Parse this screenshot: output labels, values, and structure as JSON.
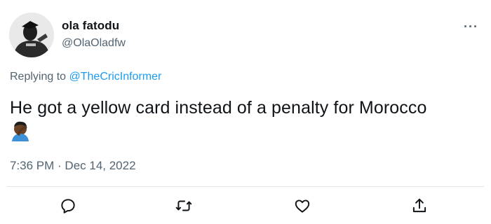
{
  "author": {
    "display_name": "ola fatodu",
    "handle": "@OlaOladfw"
  },
  "reply": {
    "prefix": "Replying to",
    "mention": "@TheCricInformer"
  },
  "tweet": {
    "text": "He got a yellow card instead of a penalty for Morocco",
    "emoji": "face-palm-emoji",
    "timestamp": "7:36 PM · Dec 14, 2022"
  },
  "menu": {
    "more_label": "···"
  },
  "actions": [
    {
      "icon": "reply-icon"
    },
    {
      "icon": "retweet-icon"
    },
    {
      "icon": "like-icon"
    },
    {
      "icon": "share-icon"
    }
  ],
  "colors": {
    "text": "#0f1419",
    "secondary": "#536471",
    "link": "#1d9bf0",
    "divider": "#e3e7ea"
  }
}
